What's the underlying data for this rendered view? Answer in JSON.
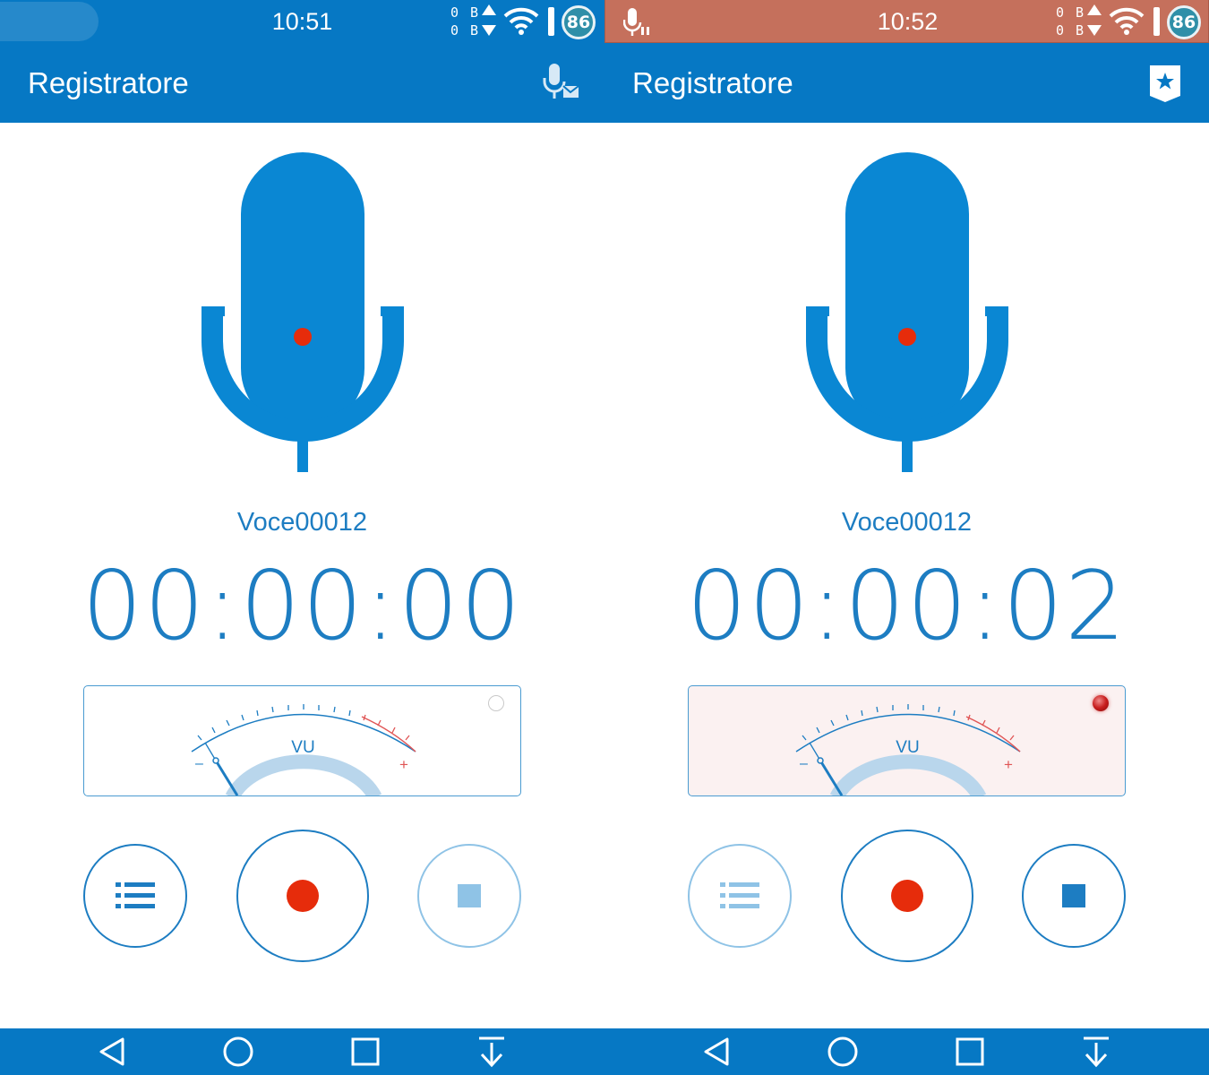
{
  "screens": [
    {
      "status_bar": {
        "time": "10:51",
        "net_up": "0 B",
        "net_down": "0 B",
        "badge": "86"
      },
      "app": {
        "title": "Registratore",
        "action_icon": "mic-stop-icon"
      },
      "recording": {
        "name": "Voce00012",
        "elapsed": "00:00:00"
      },
      "vu": {
        "label": "VU",
        "minus": "–",
        "plus": "+",
        "led_on": false
      },
      "controls": {
        "list_enabled": true,
        "record_state": "idle",
        "stop_enabled": false
      }
    },
    {
      "status_bar": {
        "time": "10:52",
        "net_up": "0 B",
        "net_down": "0 B",
        "badge": "86"
      },
      "app": {
        "title": "Registratore",
        "action_icon": "bookmark-star-icon"
      },
      "recording": {
        "name": "Voce00012",
        "elapsed": "00:00:02"
      },
      "vu": {
        "label": "VU",
        "minus": "–",
        "plus": "+",
        "led_on": true
      },
      "controls": {
        "list_enabled": false,
        "record_state": "recording",
        "stop_enabled": true
      }
    }
  ],
  "nav": [
    "back-icon",
    "home-icon",
    "recents-icon",
    "notification-pull-icon"
  ],
  "colors": {
    "primary": "#0678c4",
    "accent": "#1d7dc2",
    "record": "#e62c0b",
    "recording_status_bar": "#c5705c"
  }
}
